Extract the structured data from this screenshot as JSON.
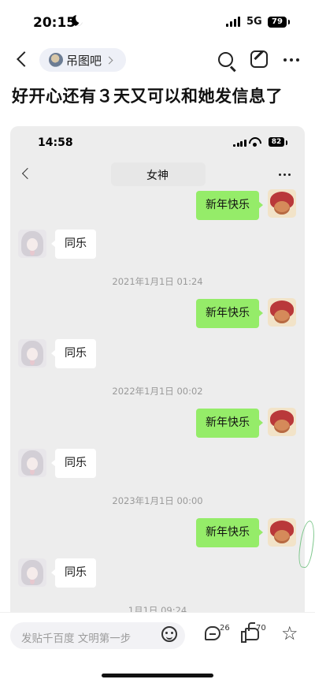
{
  "status_bar": {
    "time": "20:15",
    "network": "5G",
    "battery": "79"
  },
  "header": {
    "forum_name": "吊图吧"
  },
  "post": {
    "title": "好开心还有３天又可以和她发信息了"
  },
  "screenshot": {
    "status": {
      "time": "14:58",
      "battery": "82"
    },
    "chat_title": "女神",
    "messages": {
      "m1": "新年快乐",
      "r1": "同乐",
      "t2": "2021年1月1日 01:24",
      "m2": "新年快乐",
      "r2": "同乐",
      "t3": "2022年1月1日 00:02",
      "m3": "新年快乐",
      "r3": "同乐",
      "t4": "2023年1月1日 00:00",
      "m4": "新年快乐",
      "r4": "同乐",
      "t5": "1月1日 09:24"
    }
  },
  "bottom_bar": {
    "reply_placeholder": "发贴千百度 文明第一步",
    "comment_count": "26",
    "like_count": "70"
  },
  "icons": [
    "back-icon",
    "forum-avatar-icon",
    "search-icon",
    "edit-icon",
    "more-icon",
    "emoji-icon",
    "comment-icon",
    "like-icon",
    "star-icon"
  ],
  "colors": {
    "my_bubble": "#95ec69",
    "her_bubble": "#ffffff",
    "chat_background": "#ededed"
  }
}
